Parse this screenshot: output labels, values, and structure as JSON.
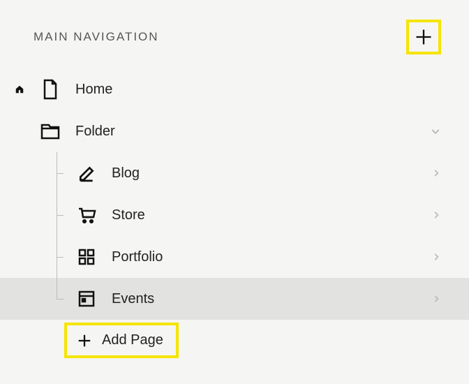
{
  "header": {
    "title": "MAIN NAVIGATION"
  },
  "nav": {
    "home": {
      "label": "Home"
    },
    "folder": {
      "label": "Folder"
    },
    "children": [
      {
        "label": "Blog"
      },
      {
        "label": "Store"
      },
      {
        "label": "Portfolio"
      },
      {
        "label": "Events"
      }
    ],
    "addPage": {
      "label": "Add Page"
    }
  }
}
